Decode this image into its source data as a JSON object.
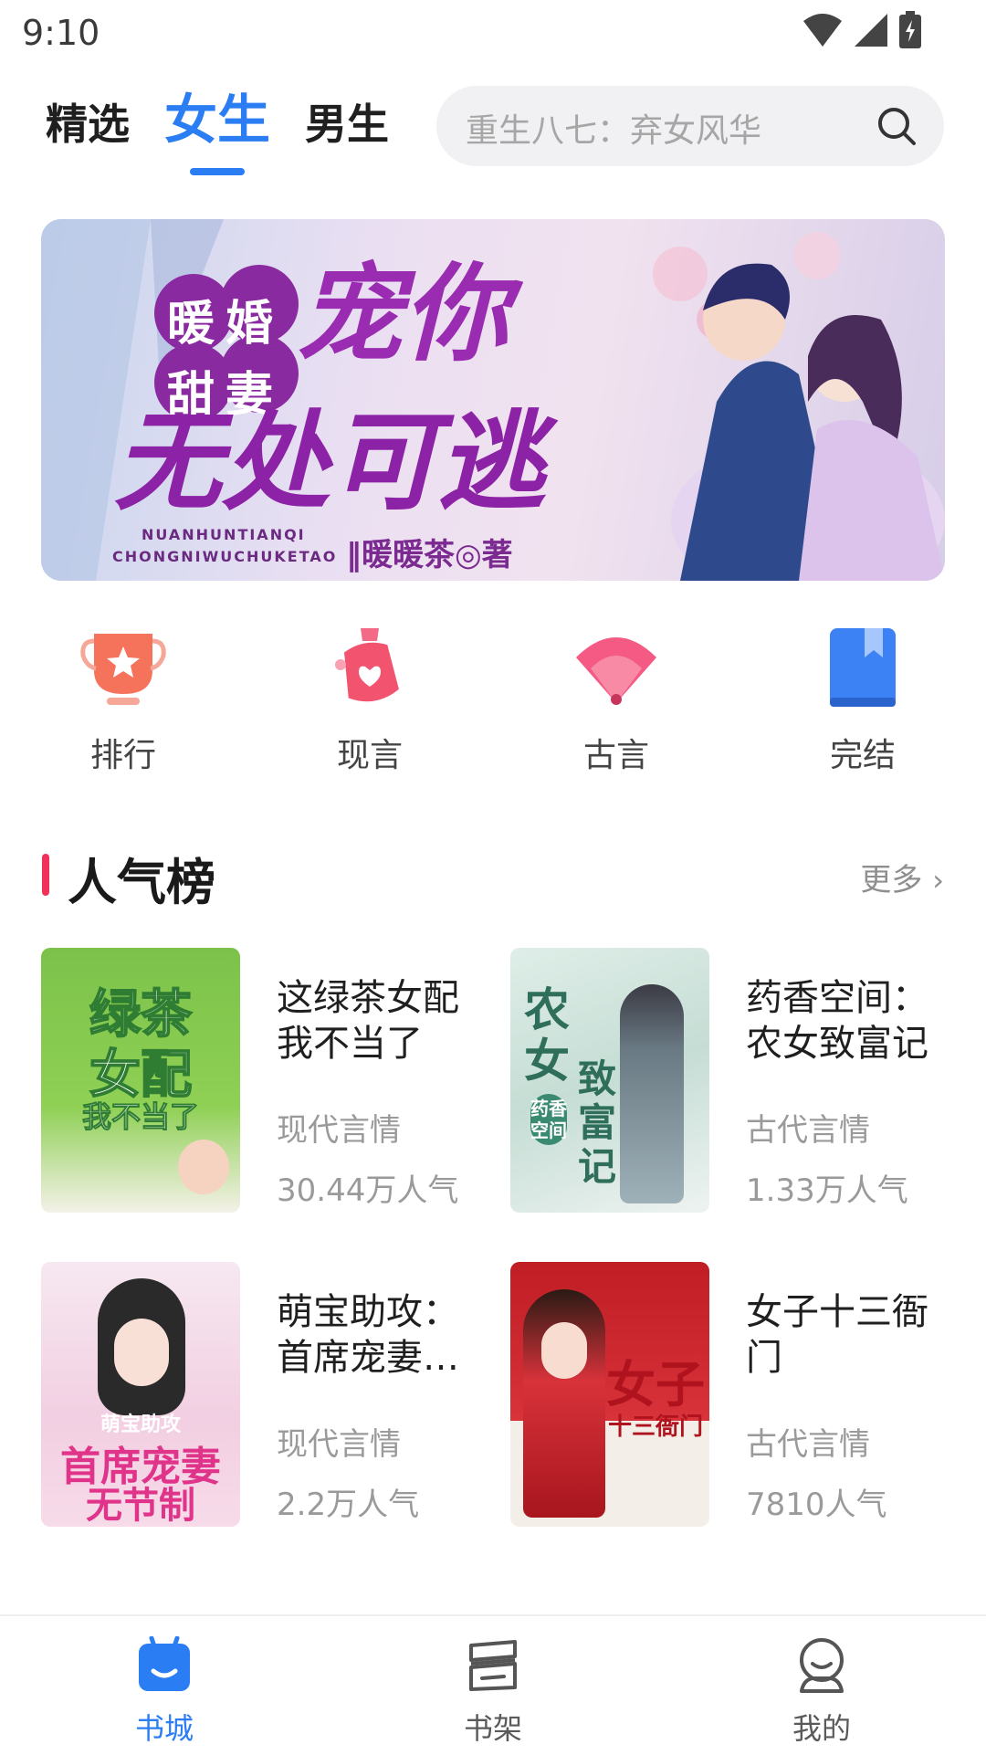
{
  "status": {
    "time": "9:10"
  },
  "tabs": [
    {
      "label": "精选",
      "active": false
    },
    {
      "label": "女生",
      "active": true
    },
    {
      "label": "男生",
      "active": false
    }
  ],
  "search": {
    "placeholder": "重生八七：弃女风华"
  },
  "banner": {
    "title_line1": "暖婚",
    "title_line2": "甜妻",
    "title_big1": "宠你",
    "title_big2": "无处可逃",
    "pinyin1": "NUANHUNTIANQI",
    "pinyin2": "CHONGNIWUCHUKETAO",
    "author": "‖暖暖茶◎著"
  },
  "quick_links": [
    {
      "label": "排行",
      "icon": "trophy-icon"
    },
    {
      "label": "现言",
      "icon": "perfume-icon"
    },
    {
      "label": "古言",
      "icon": "fan-icon"
    },
    {
      "label": "完结",
      "icon": "book-icon"
    }
  ],
  "section": {
    "title": "人气榜",
    "more": "更多"
  },
  "books": [
    {
      "title": "这绿茶女配我不当了",
      "genre": "现代言情",
      "popularity": "30.44万人气"
    },
    {
      "title": "药香空间：农女致富记",
      "genre": "古代言情",
      "popularity": "1.33万人气"
    },
    {
      "title": "萌宝助攻：首席宠妻…",
      "genre": "现代言情",
      "popularity": "2.2万人气"
    },
    {
      "title": "女子十三衙门",
      "genre": "古代言情",
      "popularity": "7810人气"
    }
  ],
  "covers": [
    {
      "text1": "绿茶",
      "text2": "女配",
      "text3": "我不当了"
    },
    {
      "text1": "农女",
      "text2": "致富记",
      "text3": "药香空间"
    },
    {
      "text1": "萌宝助攻",
      "text2": "首席宠妻",
      "text3": "无节制"
    },
    {
      "text1": "女子",
      "text2": "十三衙门",
      "text3": ""
    }
  ],
  "bottom_nav": [
    {
      "label": "书城",
      "active": true
    },
    {
      "label": "书架",
      "active": false
    },
    {
      "label": "我的",
      "active": false
    }
  ],
  "colors": {
    "accent": "#2a7df3",
    "section_marker": "#f0325a"
  }
}
